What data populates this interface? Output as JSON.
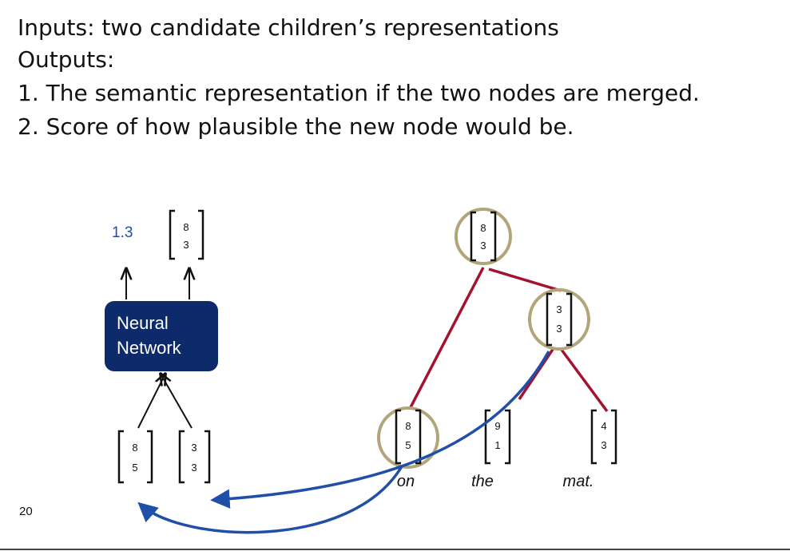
{
  "text": {
    "inputs": "Inputs: two candidate children’s representations",
    "outputs": "Outputs:",
    "item1": "1. The semantic representation if the two nodes are merged.",
    "item2": "2. Score of how plausible the new node would be."
  },
  "network": {
    "score": "1.3",
    "label_line1": "Neural",
    "label_line2": "Network",
    "output_vector": [
      "8",
      "3"
    ],
    "left_input_vector": [
      "8",
      "5"
    ],
    "right_input_vector": [
      "3",
      "3"
    ]
  },
  "tree": {
    "root_vector": [
      "8",
      "3"
    ],
    "mid_vector": [
      "3",
      "3"
    ],
    "leaves": [
      {
        "word": "on",
        "vector": [
          "8",
          "5"
        ]
      },
      {
        "word": "the",
        "vector": [
          "9",
          "1"
        ]
      },
      {
        "word": "mat.",
        "vector": [
          "4",
          "3"
        ]
      }
    ]
  },
  "colors": {
    "network_box": "#0d2a6b",
    "tree_edge": "#a3122f",
    "highlight_circle": "#b3a57a",
    "arrow_blue": "#1f4fa8",
    "score_text": "#1f4fa8"
  },
  "footer": {
    "slide_number": "20"
  }
}
